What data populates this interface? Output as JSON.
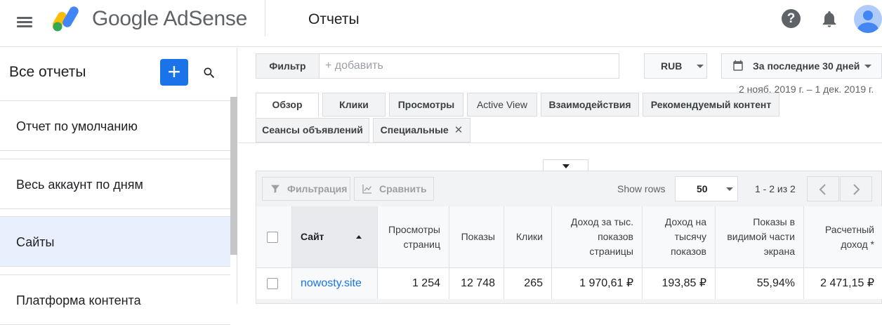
{
  "app": {
    "brand": "Google AdSense",
    "page_title": "Отчеты",
    "colors": {
      "accent": "#1a73e8",
      "active_item_bg": "#e8f0fe"
    }
  },
  "sidebar": {
    "title": "Все отчеты",
    "add_icon": "plus-icon",
    "search_icon": "search-icon",
    "items": [
      {
        "label": "Отчет по умолчанию",
        "active": false
      },
      {
        "label": "Весь аккаунт по дням",
        "active": false
      },
      {
        "label": "Сайты",
        "active": true
      },
      {
        "label": "Платформа контента",
        "active": false
      }
    ]
  },
  "filter": {
    "label": "Фильтр",
    "placeholder": "+ добавить"
  },
  "currency": {
    "value": "RUB"
  },
  "date_range": {
    "label": "За последние 30 дней",
    "sub": "2 нояб. 2019 г. – 1 дек. 2019 г."
  },
  "tabs": [
    {
      "label": "Обзор",
      "active": true
    },
    {
      "label": "Клики"
    },
    {
      "label": "Просмотры"
    },
    {
      "label": "Active View"
    },
    {
      "label": "Взаимодействия"
    },
    {
      "label": "Рекомендуемый контент"
    },
    {
      "label": "Сеансы объявлений"
    },
    {
      "label": "Специальные",
      "closable": true
    }
  ],
  "table_toolbar": {
    "filter_label": "Фильтрация",
    "compare_label": "Сравнить",
    "show_rows_label": "Show rows",
    "rows_value": "50",
    "page_range": "1 - 2 из 2"
  },
  "table": {
    "columns": [
      "Сайт",
      "Просмотры страниц",
      "Показы",
      "Клики",
      "Доход за тыс. показов страницы",
      "Доход на тысячу показов",
      "Показы в видимой части экрана",
      "Расчетный доход *"
    ],
    "sort_column": "Сайт",
    "sort_direction": "asc",
    "rows": [
      [
        "nowosty.site",
        "1 254",
        "12 748",
        "265",
        "1 970,61 ₽",
        "193,85 ₽",
        "55,94%",
        "2 471,15 ₽"
      ]
    ]
  }
}
